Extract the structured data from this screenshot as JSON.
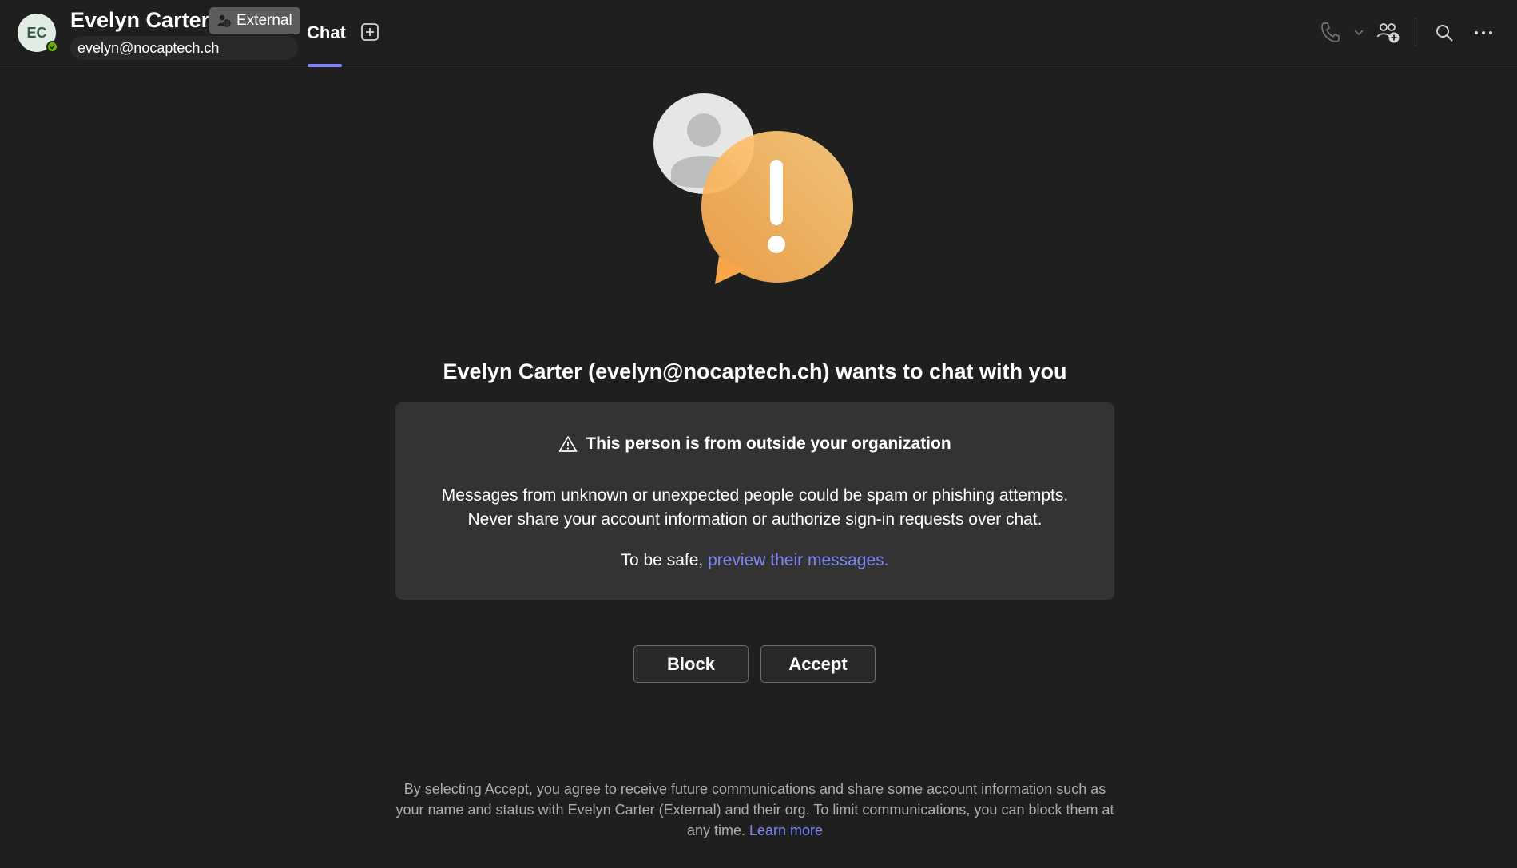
{
  "header": {
    "avatar_initials": "EC",
    "contact_name": "Evelyn Carter",
    "external_badge": "External",
    "contact_email": "evelyn@nocaptech.ch",
    "tabs": [
      {
        "label": "Chat",
        "active": true
      }
    ],
    "icons": [
      "call-icon",
      "chevron-down-icon",
      "add-people-icon",
      "search-icon",
      "more-options-icon"
    ]
  },
  "main": {
    "headline": "Evelyn Carter (evelyn@nocaptech.ch) wants to chat with you",
    "warning": {
      "title": "This person is from outside your organization",
      "line1": "Messages from unknown or unexpected people could be spam or phishing attempts.",
      "line2": "Never share your account information or authorize sign-in requests over chat.",
      "safe_prefix": "To be safe,",
      "safe_link": "preview their messages."
    },
    "buttons": {
      "block": "Block",
      "accept": "Accept"
    },
    "footer": {
      "text": "By selecting Accept, you agree to receive future communications and share some account information such as your name and status with Evelyn Carter (External) and their org. To limit communications, you can block them at any time.",
      "link": "Learn more"
    }
  },
  "colors": {
    "background": "#1f1f1f",
    "card": "#333333",
    "accent": "#7f85f5",
    "presence": "#6bb700",
    "warning_orange": "#ffb347"
  }
}
